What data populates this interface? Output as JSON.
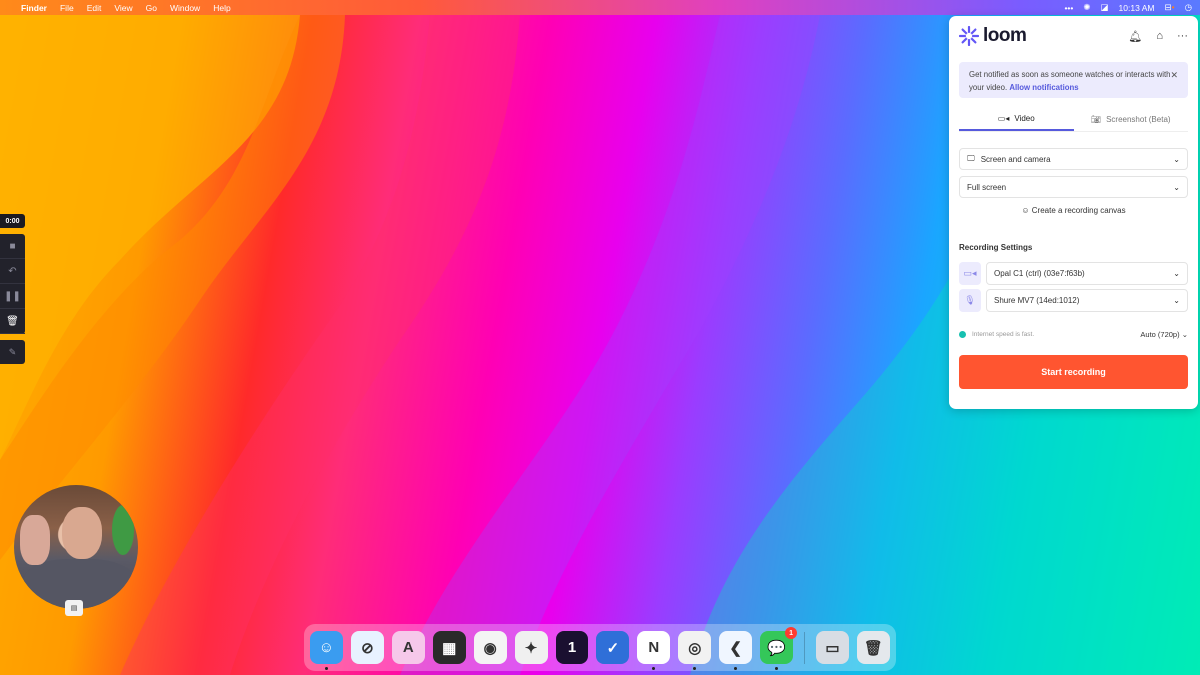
{
  "menubar": {
    "app_name": "Finder",
    "menus": [
      "File",
      "Edit",
      "View",
      "Go",
      "Window",
      "Help"
    ],
    "time": "10:13 AM"
  },
  "loom": {
    "brand": "loom",
    "notice": {
      "text": "Get notified as soon as someone watches or interacts with your video.",
      "link": "Allow notifications"
    },
    "tabs": [
      {
        "label": "Video",
        "icon": "video-camera-icon"
      },
      {
        "label": "Screenshot (Beta)",
        "icon": "camera-icon"
      }
    ],
    "mode_select": "Screen and camera",
    "area_select": "Full screen",
    "canvas_link": "Create a recording canvas",
    "settings_title": "Recording Settings",
    "camera_select": "Opal C1 (ctrl) (03e7:f63b)",
    "mic_select": "Shure MV7 (14ed:1012)",
    "speed_status": "Internet speed is fast.",
    "quality": "Auto (720p)",
    "start_label": "Start recording",
    "accent": "#565add",
    "start_color": "#ff5530"
  },
  "recorder": {
    "timer": "0:00"
  },
  "dock": {
    "apps": [
      {
        "name": "Finder",
        "glyph": "☺",
        "bg": "#3a9cf0",
        "dot": true
      },
      {
        "name": "Safari",
        "glyph": "⊘",
        "bg": "#e8f2ff",
        "dot": false
      },
      {
        "name": "Arc",
        "glyph": "A",
        "bg": "#f6c8ea",
        "dot": false
      },
      {
        "name": "Final Cut Pro",
        "glyph": "▦",
        "bg": "#2a2a2a",
        "dot": false
      },
      {
        "name": "Claquette",
        "glyph": "◉",
        "bg": "#f4f4f4",
        "dot": false
      },
      {
        "name": "Figma",
        "glyph": "✦",
        "bg": "#f0f0f0",
        "dot": false
      },
      {
        "name": "1Password",
        "glyph": "1",
        "bg": "#1a1030",
        "dot": false
      },
      {
        "name": "Things",
        "glyph": "✓",
        "bg": "#2f6fd8",
        "dot": false
      },
      {
        "name": "Notion",
        "glyph": "N",
        "bg": "#ffffff",
        "dot": true
      },
      {
        "name": "Chrome",
        "glyph": "◎",
        "bg": "#f2f2f2",
        "dot": true
      },
      {
        "name": "VS Code",
        "glyph": "❮",
        "bg": "#f0f6ff",
        "dot": true
      },
      {
        "name": "Messages",
        "glyph": "💬",
        "bg": "#34c759",
        "dot": true,
        "badge": "1"
      },
      {
        "name": "Scanner",
        "glyph": "▭",
        "bg": "#d8dde4",
        "dot": false
      },
      {
        "name": "Trash",
        "glyph": "🗑",
        "bg": "#e4e8ec",
        "dot": false
      }
    ]
  }
}
